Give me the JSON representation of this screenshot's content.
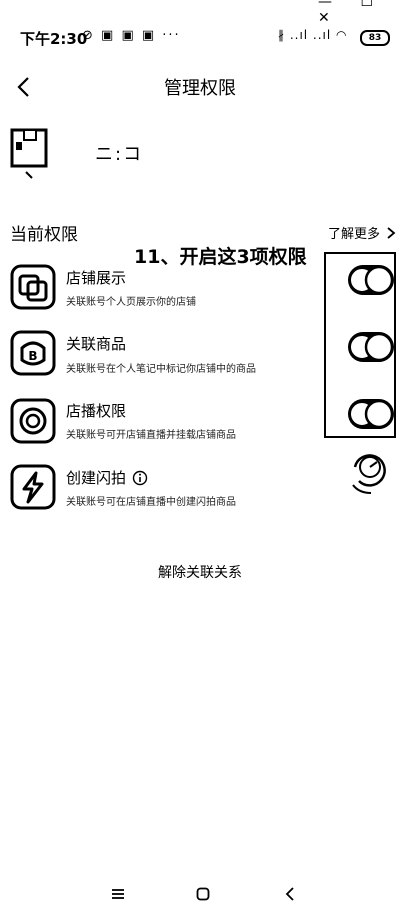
{
  "status_bar": {
    "time": "下午2:30",
    "left_icons": "⊘ ▣ ▣ ▣ ···",
    "right_icons": "∦ ..ıl ..ıl ◠",
    "battery": "83"
  },
  "header": {
    "title": "管理权限"
  },
  "account": {
    "name": "ニ:コ"
  },
  "section": {
    "label": "当前权限",
    "more": "了解更多"
  },
  "annotation": "11、开启这3项权限",
  "permissions": [
    {
      "title": "店铺展示",
      "desc": "关联账号个人页展示你的店铺",
      "icon": "shop-display-icon",
      "enabled": true
    },
    {
      "title": "关联商品",
      "desc": "关联账号在个人笔记中标记你店铺中的商品",
      "icon": "linked-goods-icon",
      "enabled": true
    },
    {
      "title": "店播权限",
      "desc": "关联账号可开店铺直播并挂载店铺商品",
      "icon": "live-stream-icon",
      "enabled": true
    },
    {
      "title": "创建闪拍",
      "desc": "关联账号可在店铺直播中创建闪拍商品",
      "icon": "flash-sale-icon",
      "enabled": false
    }
  ],
  "actions": {
    "unlink": "解除关联关系"
  },
  "colors": {
    "background": "#ffffff",
    "foreground": "#000000"
  }
}
